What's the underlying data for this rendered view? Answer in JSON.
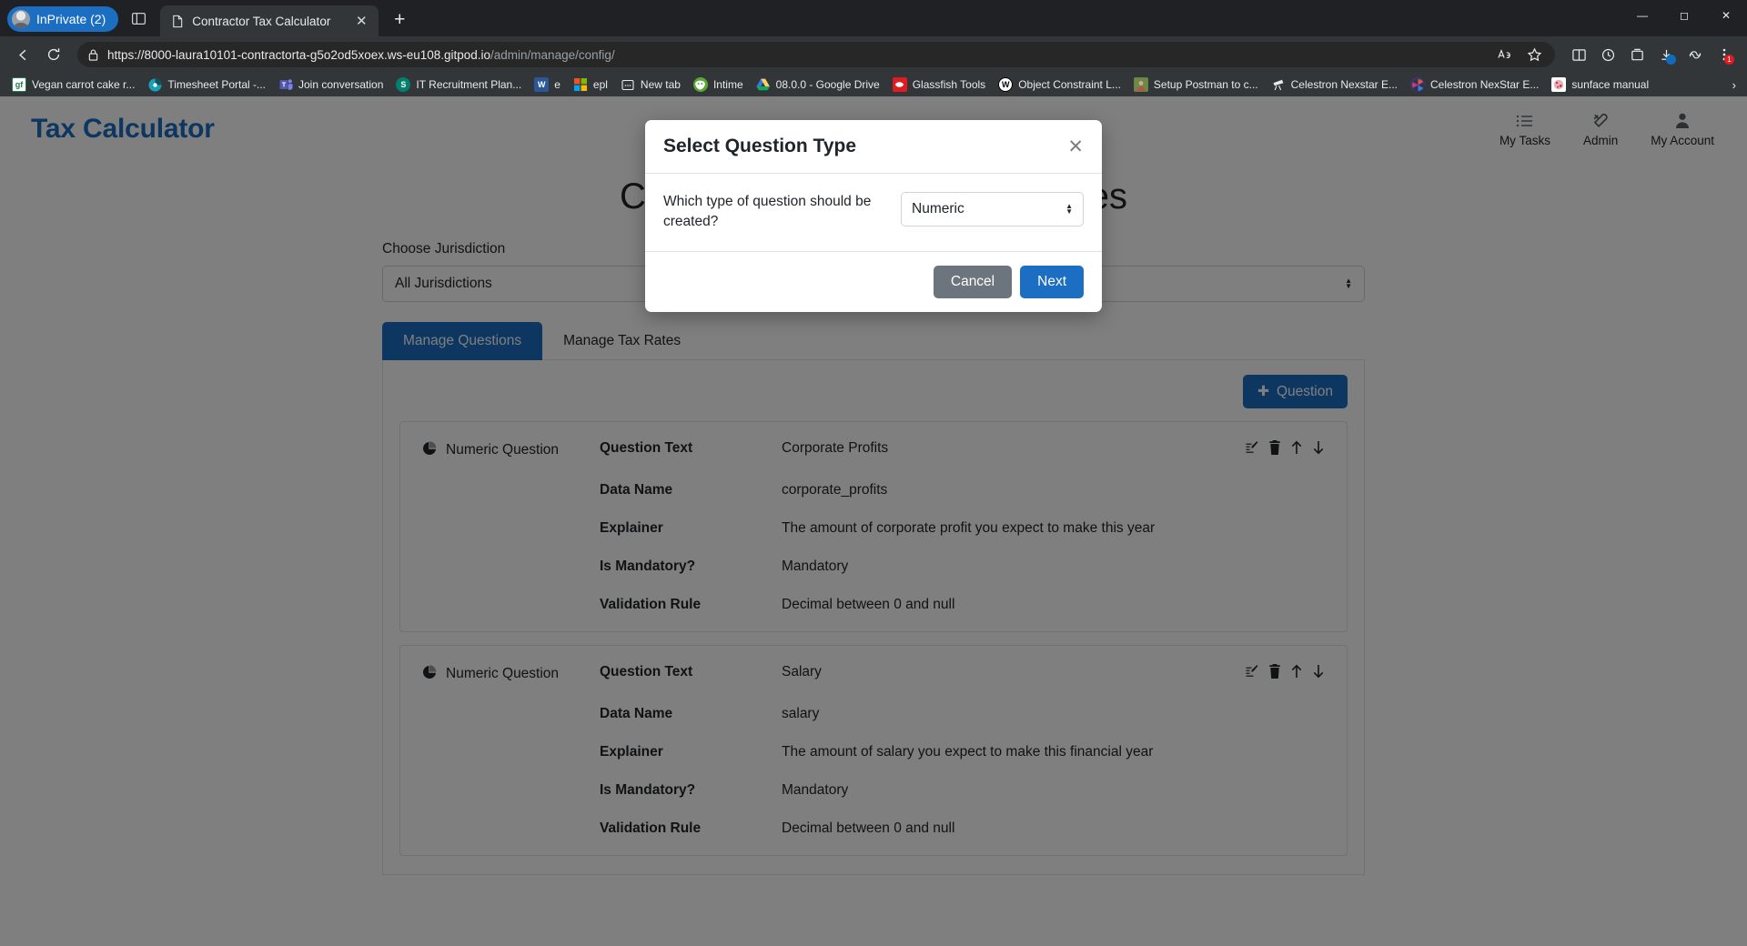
{
  "browser": {
    "profile_pill": "InPrivate (2)",
    "tab_title": "Contractor Tax Calculator",
    "url_prefix": "https://8000-laura10101-contractorta-g5o2od5xoex.ws-eu108.gitpod.io",
    "url_path": "/admin/manage/config/",
    "copilot_badge": "1",
    "downloads_badge": "",
    "bookmarks": [
      {
        "label": "Vegan carrot cake r...",
        "icon": "gf-icon",
        "color": "#ffffff",
        "text": "gf",
        "fg": "#1f7a4d"
      },
      {
        "label": "Timesheet Portal -...",
        "icon": "timesheet-portal-icon",
        "color": "#17a2b8",
        "text": "",
        "fg": "#ffffff"
      },
      {
        "label": "Join conversation",
        "icon": "teams-icon",
        "color": "#5558af",
        "text": "T",
        "fg": "#ffffff"
      },
      {
        "label": "IT Recruitment Plan...",
        "icon": "sharepoint-icon",
        "color": "#037f6e",
        "text": "S",
        "fg": "#ffffff"
      },
      {
        "label": "e",
        "icon": "word-icon",
        "color": "#2b5797",
        "text": "W",
        "fg": "#ffffff"
      },
      {
        "label": "epl",
        "icon": "microsoft-icon",
        "color": "#f25022",
        "text": "",
        "fg": "#ffffff"
      },
      {
        "label": "New tab",
        "icon": "new-tab-icon",
        "color": "#323639",
        "text": "",
        "fg": "#e8eaed"
      },
      {
        "label": "Intime",
        "icon": "intime-icon",
        "color": "#5aa832",
        "text": "",
        "fg": "#ffffff"
      },
      {
        "label": "08.0.0 - Google Drive",
        "icon": "google-drive-icon",
        "color": "#323639",
        "text": "",
        "fg": "#ffffff"
      },
      {
        "label": "Glassfish Tools",
        "icon": "glassfish-icon",
        "color": "#e11b22",
        "text": "",
        "fg": "#ffffff"
      },
      {
        "label": "Object Constraint L...",
        "icon": "wikipedia-icon",
        "color": "#ffffff",
        "text": "W",
        "fg": "#000000"
      },
      {
        "label": "Setup Postman to c...",
        "icon": "photo-thumbnail-icon",
        "color": "#6b7f4a",
        "text": "",
        "fg": "#ffffff"
      },
      {
        "label": "Celestron Nexstar E...",
        "icon": "telescope-icon",
        "color": "#323639",
        "text": "",
        "fg": "#e8eaed"
      },
      {
        "label": "Celestron NexStar E...",
        "icon": "aperture-icon",
        "color": "#3b3b6d",
        "text": "",
        "fg": "#ffffff"
      },
      {
        "label": "sunface manual",
        "icon": "sunface-icon",
        "color": "#ffffff",
        "text": "",
        "fg": "#cc3344"
      }
    ],
    "overflow_chevron": "›"
  },
  "site": {
    "brand": "Tax Calculator",
    "nav": [
      {
        "label": "My Tasks",
        "icon": "tasks-icon"
      },
      {
        "label": "Admin",
        "icon": "tools-icon"
      },
      {
        "label": "My Account",
        "icon": "person-icon"
      }
    ],
    "page_title": "Configure Questions and Rates"
  },
  "filters": {
    "jurisdiction_label": "Choose Jurisdiction",
    "jurisdiction_value": "All Jurisdictions"
  },
  "tabs": [
    {
      "label": "Manage Questions",
      "active": true
    },
    {
      "label": "Manage Tax Rates",
      "active": false
    }
  ],
  "toolbar": {
    "add_question_label": "Question",
    "add_question_icon": "plus-icon"
  },
  "question_cards": [
    {
      "type_label": "Numeric Question",
      "type_icon": "pie-chart-icon",
      "rows": [
        {
          "label": "Question Text",
          "value": "Corporate Profits"
        },
        {
          "label": "Data Name",
          "value": "corporate_profits"
        },
        {
          "label": "Explainer",
          "value": "The amount of corporate profit you expect to make this year"
        },
        {
          "label": "Is Mandatory?",
          "value": "Mandatory"
        },
        {
          "label": "Validation Rule",
          "value": "Decimal between 0 and null"
        }
      ],
      "actions": [
        "edit-icon",
        "delete-icon",
        "move-up-icon",
        "move-down-icon"
      ]
    },
    {
      "type_label": "Numeric Question",
      "type_icon": "pie-chart-icon",
      "rows": [
        {
          "label": "Question Text",
          "value": "Salary"
        },
        {
          "label": "Data Name",
          "value": "salary"
        },
        {
          "label": "Explainer",
          "value": "The amount of salary you expect to make this financial year"
        },
        {
          "label": "Is Mandatory?",
          "value": "Mandatory"
        },
        {
          "label": "Validation Rule",
          "value": "Decimal between 0 and null"
        }
      ],
      "actions": [
        "edit-icon",
        "delete-icon",
        "move-up-icon",
        "move-down-icon"
      ]
    }
  ],
  "modal": {
    "title": "Select Question Type",
    "close_icon": "close-icon",
    "question": "Which type of question should be created?",
    "select_value": "Numeric",
    "cancel_label": "Cancel",
    "next_label": "Next"
  },
  "colors": {
    "brand_blue": "#1b6ec2",
    "secondary_gray": "#6c757d",
    "border": "#dee2e6"
  }
}
